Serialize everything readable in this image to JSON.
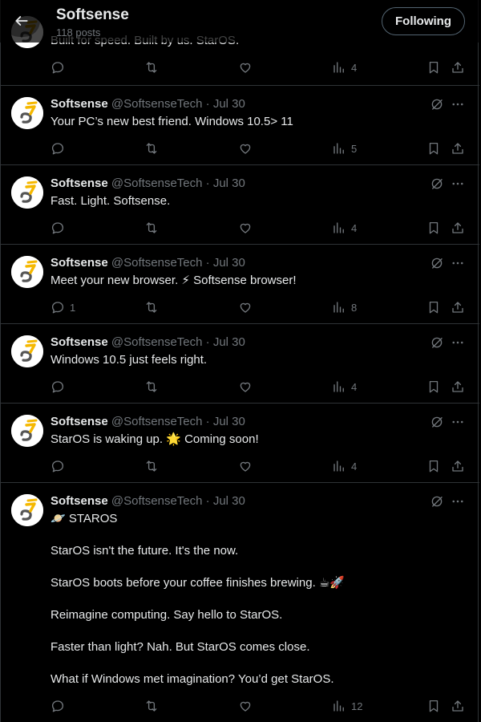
{
  "header": {
    "title": "Softsense",
    "subtitle": "118 posts",
    "follow_label": "Following"
  },
  "partial_post": {
    "text": "Built for speed. Built by us. StarOS.",
    "views": "4"
  },
  "posts": [
    {
      "name": "Softsense",
      "meta": "@SoftsenseTech · Jul 30",
      "paragraphs": [
        "Your PC’s new best friend. Windows 10.5> 11"
      ],
      "replies": "",
      "reposts": "",
      "likes": "",
      "views": "5"
    },
    {
      "name": "Softsense",
      "meta": "@SoftsenseTech · Jul 30",
      "paragraphs": [
        "Fast. Light. Softsense."
      ],
      "replies": "",
      "reposts": "",
      "likes": "",
      "views": "4"
    },
    {
      "name": "Softsense",
      "meta": "@SoftsenseTech · Jul 30",
      "paragraphs": [
        "Meet your new browser. ⚡ Softsense browser!"
      ],
      "replies": "1",
      "reposts": "",
      "likes": "",
      "views": "8"
    },
    {
      "name": "Softsense",
      "meta": "@SoftsenseTech · Jul 30",
      "paragraphs": [
        "Windows 10.5 just feels right."
      ],
      "replies": "",
      "reposts": "",
      "likes": "",
      "views": "4"
    },
    {
      "name": "Softsense",
      "meta": "@SoftsenseTech · Jul 30",
      "paragraphs": [
        "StarOS is waking up. 🌟 Coming soon!"
      ],
      "replies": "",
      "reposts": "",
      "likes": "",
      "views": "4"
    },
    {
      "name": "Softsense",
      "meta": "@SoftsenseTech · Jul 30",
      "paragraphs": [
        "🪐 STAROS",
        "StarOS isn't the future. It's the now.",
        "StarOS boots before your coffee finishes brewing. ☕🚀",
        "Reimagine computing. Say hello to StarOS.",
        "Faster than light? Nah. But StarOS comes close.",
        "What if Windows met imagination? You’d get StarOS."
      ],
      "replies": "",
      "reposts": "",
      "likes": "",
      "views": "12"
    }
  ]
}
